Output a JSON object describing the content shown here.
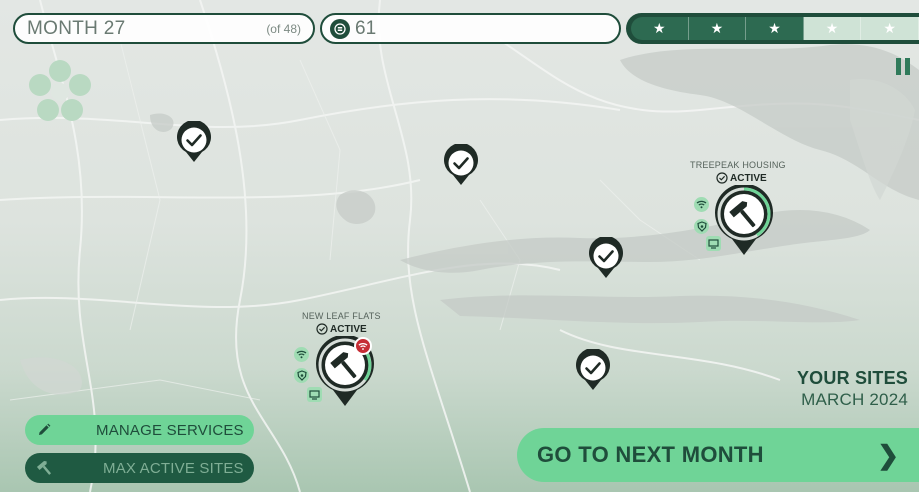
{
  "hud": {
    "month_label": "MONTH 27",
    "month_total": "(of 48)",
    "coins": "61",
    "stars_total": 5,
    "stars_earned": 3
  },
  "sites": [
    {
      "name": "TREEPEAK HOUSING",
      "status": "ACTIVE"
    },
    {
      "name": "NEW LEAF FLATS",
      "status": "ACTIVE"
    }
  ],
  "panel": {
    "title": "YOUR SITES",
    "date": "MARCH 2024"
  },
  "buttons": {
    "manage_services": "MANAGE SERVICES",
    "max_active_sites": "MAX ACTIVE SITES",
    "next_month": "GO TO NEXT MONTH"
  },
  "icons": {
    "pause": "pause-icon",
    "coin": "coin-icon",
    "star": "star-icon",
    "pencil": "pencil-icon",
    "hammer": "hammer-icon",
    "check": "check-icon",
    "wifi": "wifi-icon",
    "shield": "shield-icon",
    "monitor": "monitor-icon",
    "chevron": "chevron-right-icon"
  },
  "colors": {
    "dark_green": "#1f4d3b",
    "accent_green": "#6fd497",
    "service_green": "#9fdcb3",
    "alert_red": "#c62d35"
  }
}
